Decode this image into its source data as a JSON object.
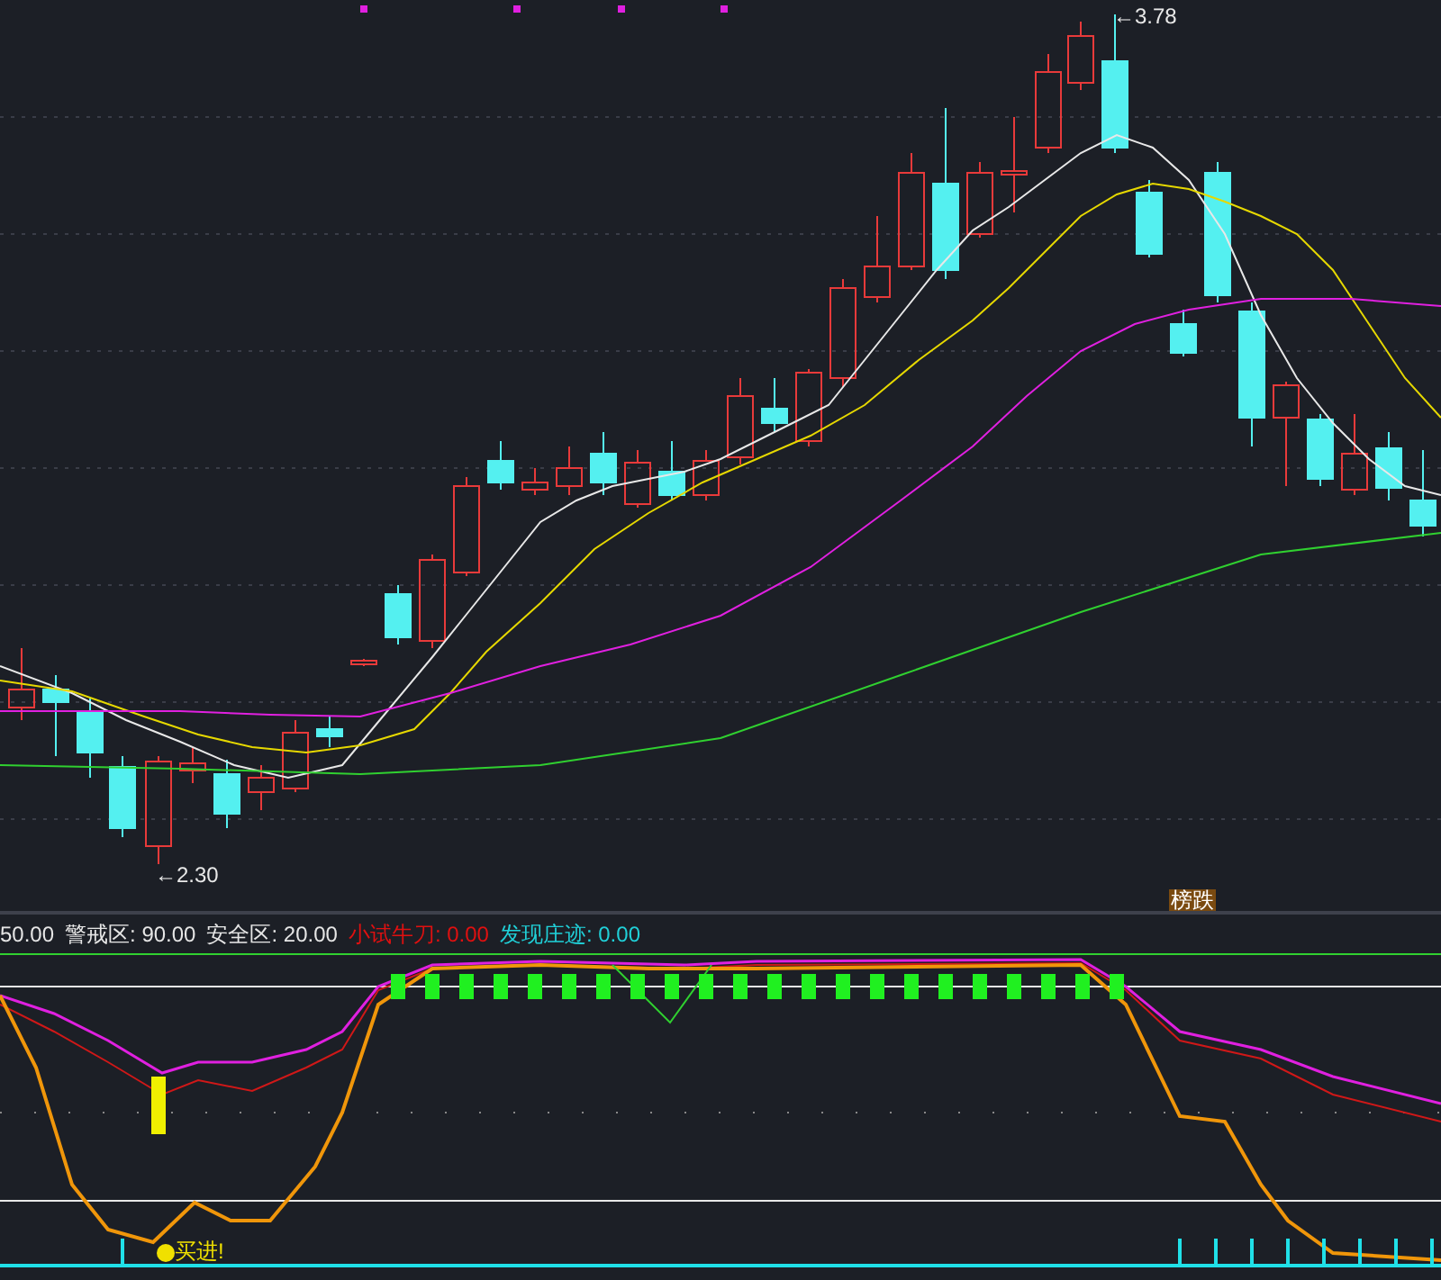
{
  "price_chart": {
    "high_label": "←3.78",
    "low_label": "←2.30",
    "badge": "榜跌"
  },
  "indicator": {
    "legend": [
      {
        "text": "50.00",
        "color": "#e6e6e6"
      },
      {
        "text": "警戒区: 90.00",
        "color": "#e6e6e6"
      },
      {
        "text": "安全区: 20.00",
        "color": "#e6e6e6"
      },
      {
        "text": "小试牛刀: 0.00",
        "color": "#e01010"
      },
      {
        "text": "发现庄迹: 0.00",
        "color": "#20d0d8"
      }
    ],
    "signal_label": "买进!"
  }
}
